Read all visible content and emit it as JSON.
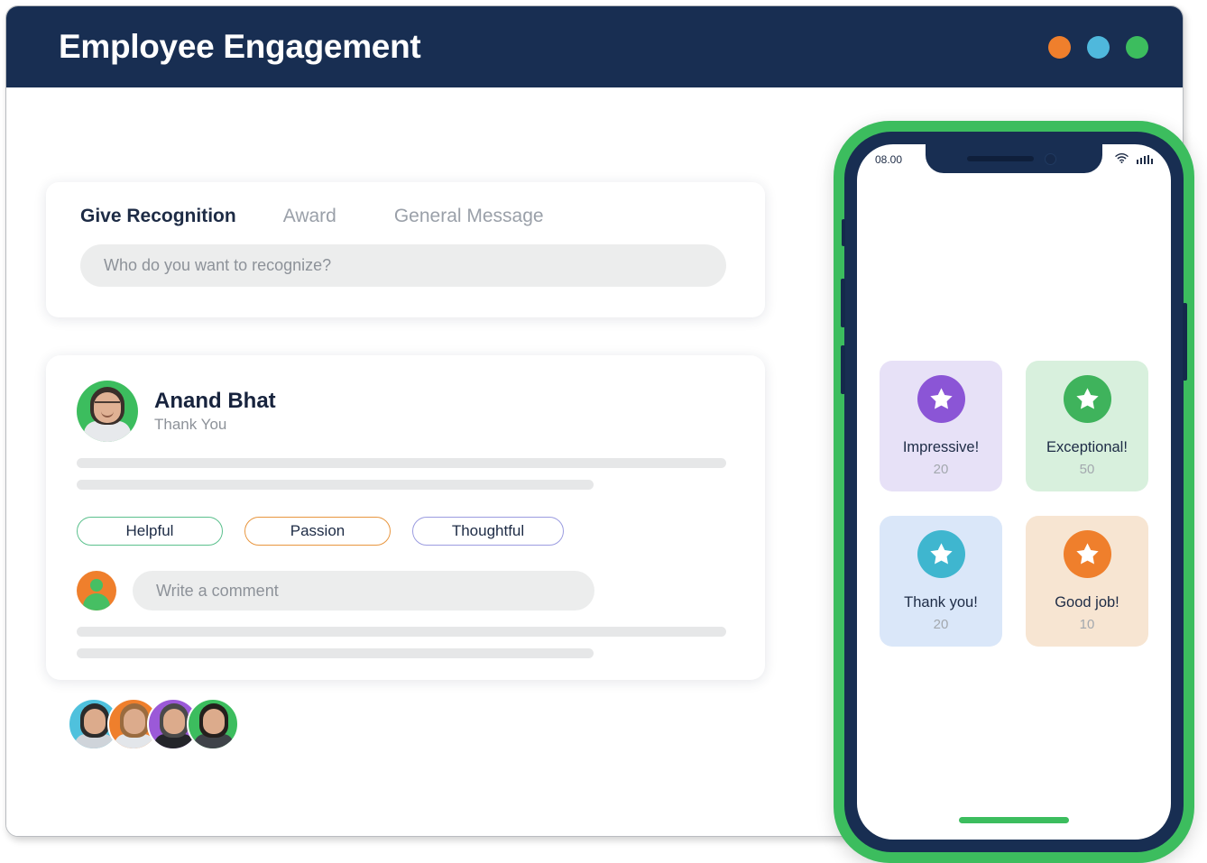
{
  "window": {
    "title": "Employee Engagement",
    "controls": [
      {
        "name": "minimize-dot",
        "color": "#ef7f2c"
      },
      {
        "name": "maximize-dot",
        "color": "#4fb8dc"
      },
      {
        "name": "close-dot",
        "color": "#3cbd5e"
      }
    ]
  },
  "composer": {
    "tabs": [
      {
        "label": "Give Recognition",
        "active": true
      },
      {
        "label": "Award",
        "active": false
      },
      {
        "label": "General Message",
        "active": false
      }
    ],
    "recognize_input": {
      "placeholder": "Who do you want to recognize?",
      "value": ""
    }
  },
  "post": {
    "author_name": "Anand Bhat",
    "subtitle": "Thank You",
    "avatar_icon": "user-photo-avatar",
    "tags": [
      {
        "label": "Helpful",
        "color": "#5bc08d"
      },
      {
        "label": "Passion",
        "color": "#e8963f"
      },
      {
        "label": "Thoughtful",
        "color": "#9b9ce0"
      }
    ],
    "comment_input": {
      "placeholder": "Write a comment",
      "value": ""
    },
    "comment_avatar_icon": "user-silhouette-avatar"
  },
  "avatar_stack": [
    {
      "name": "avatar-1",
      "bg": "#4fc1dd",
      "hair": "#2b2b2b",
      "body": "#cfd4da"
    },
    {
      "name": "avatar-2",
      "bg": "#ef7f2c",
      "hair": "#9a6b3f",
      "body": "#e3e6ea"
    },
    {
      "name": "avatar-3",
      "bg": "#9b59d8",
      "hair": "#4a4a4a",
      "body": "#24252a"
    },
    {
      "name": "avatar-4",
      "bg": "#3cbd5e",
      "hair": "#241f1d",
      "body": "#3f4349"
    }
  ],
  "phone": {
    "frame_color": "#182e52",
    "accent_color": "#3cbd5e",
    "status_bar": {
      "time": "08.00",
      "wifi_icon": "wifi-icon",
      "battery_icon": "battery-icon"
    },
    "reward_cards": [
      {
        "label": "Impressive!",
        "count": "20",
        "card_bg": "#e7e1f7",
        "badge_bg": "#8b55d6",
        "icon": "star-icon"
      },
      {
        "label": "Exceptional!",
        "count": "50",
        "card_bg": "#d8f0dd",
        "badge_bg": "#3fb35c",
        "icon": "star-icon"
      },
      {
        "label": "Thank you!",
        "count": "20",
        "card_bg": "#dae7f9",
        "badge_bg": "#3fb6cf",
        "icon": "star-icon"
      },
      {
        "label": "Good job!",
        "count": "10",
        "card_bg": "#f7e5d2",
        "badge_bg": "#ef7f2c",
        "icon": "star-icon"
      }
    ],
    "home_indicator": "home-indicator-bar"
  }
}
